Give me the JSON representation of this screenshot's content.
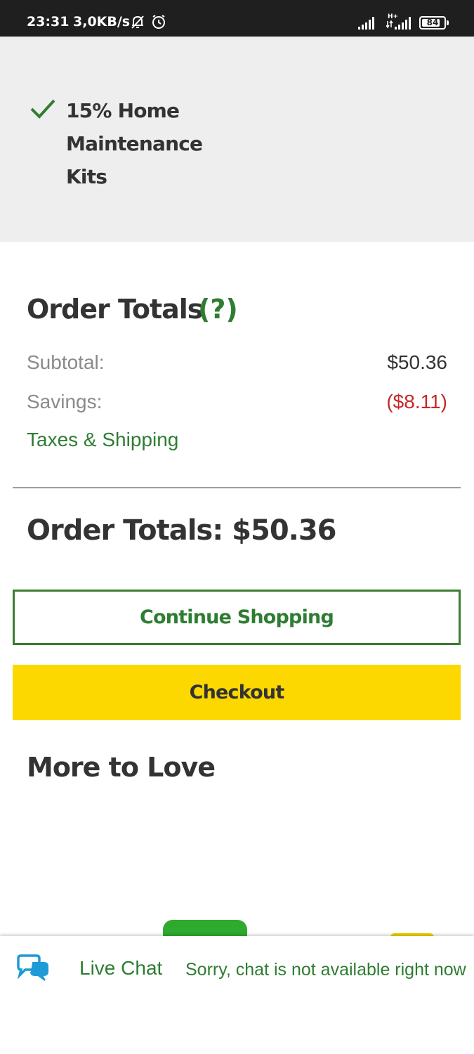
{
  "status_bar": {
    "time": "23:31",
    "speed": "3,0KB/s",
    "network_type": "H+",
    "battery_level": "84",
    "battery_fraction": 0.84
  },
  "promo": {
    "lines": [
      "15% Home",
      "Maintenance",
      "Kits"
    ],
    "icon": "check-icon"
  },
  "order_totals": {
    "title": "Order Totals",
    "help_label": "(?)",
    "subtotal_label": "Subtotal:",
    "subtotal_value": "$50.36",
    "savings_label": "Savings:",
    "savings_value": "($8.11)",
    "taxes_link": "Taxes & Shipping",
    "grand_total": "Order Totals: $50.36"
  },
  "buttons": {
    "continue_label": "Continue Shopping",
    "checkout_label": "Checkout"
  },
  "more_to_love": {
    "title": "More to Love"
  },
  "chat": {
    "label": "Live Chat",
    "status": "Sorry, chat is not available right now"
  },
  "colors": {
    "brand_green": "#2e7d32",
    "checkout_yellow": "#fdd800",
    "savings_red": "#c62828",
    "chat_blue": "#1e9bd7",
    "promo_background": "#eeeeee"
  }
}
